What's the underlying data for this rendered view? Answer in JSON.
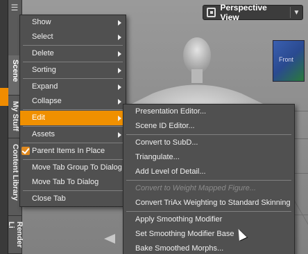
{
  "viewport": {
    "camera_label": "Perspective View",
    "cube_label": "Front"
  },
  "side_tabs": [
    {
      "label": "Scene"
    },
    {
      "label": "My Stuff"
    },
    {
      "label": "Content Library"
    },
    {
      "label": "Render Li"
    }
  ],
  "context_menu": {
    "items": [
      {
        "label": "Show",
        "submenu": true
      },
      {
        "label": "Select",
        "submenu": true
      },
      {
        "label": "Delete",
        "submenu": true
      },
      {
        "label": "Sorting",
        "submenu": true
      },
      {
        "label": "Expand",
        "submenu": true
      },
      {
        "label": "Collapse",
        "submenu": true
      },
      {
        "label": "Edit",
        "submenu": true
      },
      {
        "label": "Assets",
        "submenu": true
      },
      {
        "label": "Parent Items In Place",
        "checked": true
      },
      {
        "label": "Move Tab Group To Dialog"
      },
      {
        "label": "Move Tab To Dialog"
      },
      {
        "label": "Close Tab"
      }
    ]
  },
  "edit_submenu": {
    "items": [
      {
        "label": "Presentation Editor..."
      },
      {
        "label": "Scene ID Editor..."
      },
      {
        "label": "Convert to SubD..."
      },
      {
        "label": "Triangulate..."
      },
      {
        "label": "Add Level of Detail..."
      },
      {
        "label": "Convert to Weight Mapped Figure..."
      },
      {
        "label": "Convert TriAx Weighting to Standard Skinning"
      },
      {
        "label": "Apply Smoothing Modifier"
      },
      {
        "label": "Set Smoothing Modifier Base"
      },
      {
        "label": "Bake Smoothed Morphs..."
      }
    ]
  },
  "colors": {
    "highlight": "#f09000",
    "menu_bg": "#505050"
  }
}
